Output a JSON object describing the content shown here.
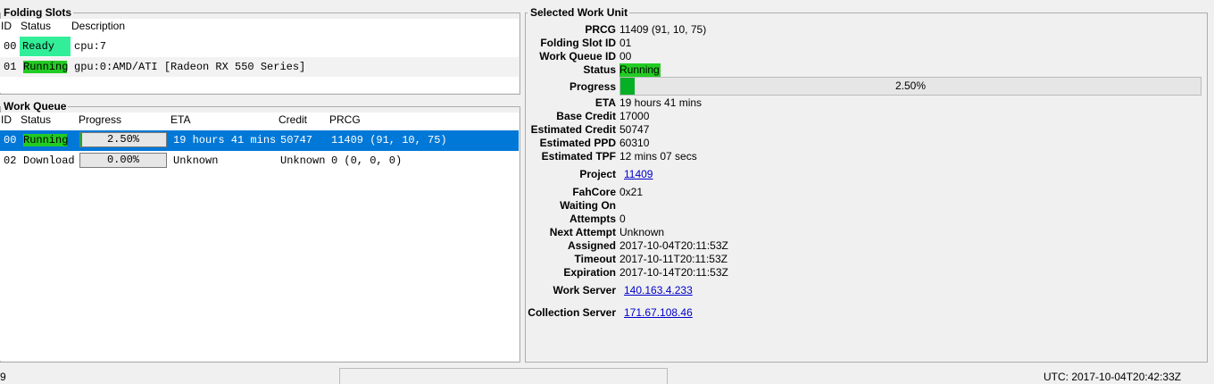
{
  "folding_slots": {
    "title": "Folding Slots",
    "columns": [
      "ID",
      "Status",
      "Description"
    ],
    "rows": [
      {
        "id": "00",
        "status": "Ready",
        "description": "cpu:7"
      },
      {
        "id": "01",
        "status": "Running",
        "description": "gpu:0:AMD/ATI [Radeon RX 550 Series]"
      }
    ]
  },
  "work_queue": {
    "title": "Work Queue",
    "columns": [
      "ID",
      "Status",
      "Progress",
      "ETA",
      "Credit",
      "PRCG"
    ],
    "rows": [
      {
        "id": "00",
        "status": "Running",
        "progress": "2.50%",
        "progress_value": 0.025,
        "eta": "19 hours 41 mins",
        "credit": "50747",
        "prcg": "11409 (91, 10, 75)",
        "selected": true
      },
      {
        "id": "02",
        "status": "Download",
        "progress": "0.00%",
        "progress_value": 0.0,
        "eta": "Unknown",
        "credit": "Unknown",
        "prcg": "0 (0, 0, 0)",
        "selected": false
      }
    ]
  },
  "selected_work_unit": {
    "title": "Selected Work Unit",
    "prcg_label": "PRCG",
    "prcg": "11409 (91, 10, 75)",
    "slot_label": "Folding Slot ID",
    "slot": "01",
    "queue_label": "Work Queue ID",
    "queue": "00",
    "status_label": "Status",
    "status": "Running",
    "progress_label": "Progress",
    "progress": "2.50%",
    "progress_value": 0.025,
    "eta_label": "ETA",
    "eta": "19 hours 41 mins",
    "base_credit_label": "Base Credit",
    "base_credit": "17000",
    "est_credit_label": "Estimated Credit",
    "est_credit": "50747",
    "est_ppd_label": "Estimated PPD",
    "est_ppd": "60310",
    "est_tpf_label": "Estimated TPF",
    "est_tpf": "12 mins 07 secs",
    "project_label": "Project",
    "project": "11409",
    "fahcore_label": "FahCore",
    "fahcore": "0x21",
    "waiting_label": "Waiting On",
    "waiting": "",
    "attempts_label": "Attempts",
    "attempts": "0",
    "next_attempt_label": "Next Attempt",
    "next_attempt": "Unknown",
    "assigned_label": "Assigned",
    "assigned": "2017-10-04T20:11:53Z",
    "timeout_label": "Timeout",
    "timeout": "2017-10-11T20:11:53Z",
    "expiration_label": "Expiration",
    "expiration": "2017-10-14T20:11:53Z",
    "work_server_label": "Work Server",
    "work_server": "140.163.4.233",
    "collection_server_label": "Collection Server",
    "collection_server": "171.67.108.46"
  },
  "statusbar": {
    "left_text": "9",
    "utc": "UTC: 2017-10-04T20:42:33Z"
  },
  "colors": {
    "ready": "#33ee99",
    "running": "#22cc22",
    "progress_fill": "#06b025",
    "selection": "#0078d7",
    "link": "#0000cc"
  }
}
